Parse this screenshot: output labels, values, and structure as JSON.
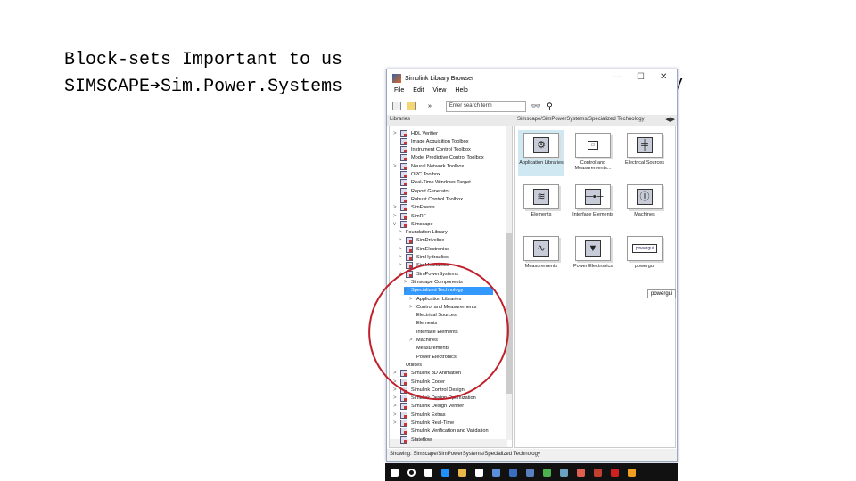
{
  "slide": {
    "line1": "Block-sets Important to us",
    "line2": "SIMSCAPE➔Sim.Power.Systems",
    "line2_tail": "y"
  },
  "window": {
    "title": "Simulink Library Browser",
    "minimize": "—",
    "maximize": "☐",
    "close": "✕"
  },
  "menu": [
    "File",
    "Edit",
    "View",
    "Help"
  ],
  "toolbar": {
    "search_placeholder": "Enter search term",
    "more": "»"
  },
  "address": {
    "left_header": "Libraries",
    "path": "Simscape/SimPowerSystems/Specialized Technology"
  },
  "tree": [
    {
      "label": "HDL Verifier",
      "level": 0,
      "exp": ">"
    },
    {
      "label": "Image Acquisition Toolbox",
      "level": 0,
      "exp": ""
    },
    {
      "label": "Instrument Control Toolbox",
      "level": 0,
      "exp": ""
    },
    {
      "label": "Model Predictive Control Toolbox",
      "level": 0,
      "exp": ""
    },
    {
      "label": "Neural Network Toolbox",
      "level": 0,
      "exp": ">"
    },
    {
      "label": "OPC Toolbox",
      "level": 0,
      "exp": ""
    },
    {
      "label": "Real-Time Windows Target",
      "level": 0,
      "exp": ""
    },
    {
      "label": "Report Generator",
      "level": 0,
      "exp": ""
    },
    {
      "label": "Robust Control Toolbox",
      "level": 0,
      "exp": ""
    },
    {
      "label": "SimEvents",
      "level": 0,
      "exp": ">"
    },
    {
      "label": "SimRF",
      "level": 0,
      "exp": ">"
    },
    {
      "label": "Simscape",
      "level": 0,
      "exp": "v"
    },
    {
      "label": "Foundation Library",
      "level": 1,
      "exp": ">",
      "noicon": true
    },
    {
      "label": "SimDriveline",
      "level": 1,
      "exp": ">"
    },
    {
      "label": "SimElectronics",
      "level": 1,
      "exp": ">"
    },
    {
      "label": "SimHydraulics",
      "level": 1,
      "exp": ">"
    },
    {
      "label": "SimMechanics",
      "level": 1,
      "exp": ">"
    },
    {
      "label": "SimPowerSystems",
      "level": 1,
      "exp": "v"
    },
    {
      "label": "Simscape Components",
      "level": 2,
      "exp": ">",
      "noicon": true
    },
    {
      "label": "Specialized Technology",
      "level": 2,
      "exp": "v",
      "noicon": true,
      "selected": true
    },
    {
      "label": "Application Libraries",
      "level": 3,
      "exp": ">",
      "noicon": true
    },
    {
      "label": "Control and Measurements",
      "level": 3,
      "exp": ">",
      "noicon": true
    },
    {
      "label": "Electrical Sources",
      "level": 3,
      "exp": "",
      "noicon": true
    },
    {
      "label": "Elements",
      "level": 3,
      "exp": "",
      "noicon": true
    },
    {
      "label": "Interface Elements",
      "level": 3,
      "exp": "",
      "noicon": true
    },
    {
      "label": "Machines",
      "level": 3,
      "exp": ">",
      "noicon": true
    },
    {
      "label": "Measurements",
      "level": 3,
      "exp": "",
      "noicon": true
    },
    {
      "label": "Power Electronics",
      "level": 3,
      "exp": "",
      "noicon": true
    },
    {
      "label": "Utilities",
      "level": 1,
      "exp": "",
      "noicon": true
    },
    {
      "label": "Simulink 3D Animation",
      "level": 0,
      "exp": ">"
    },
    {
      "label": "Simulink Coder",
      "level": 0,
      "exp": ">"
    },
    {
      "label": "Simulink Control Design",
      "level": 0,
      "exp": ">"
    },
    {
      "label": "Simulink Design Optimization",
      "level": 0,
      "exp": ">"
    },
    {
      "label": "Simulink Design Verifier",
      "level": 0,
      "exp": ">"
    },
    {
      "label": "Simulink Extras",
      "level": 0,
      "exp": ">"
    },
    {
      "label": "Simulink Real-Time",
      "level": 0,
      "exp": ">"
    },
    {
      "label": "Simulink Verification and Validation",
      "level": 0,
      "exp": ""
    },
    {
      "label": "Stateflow",
      "level": 0,
      "exp": ""
    }
  ],
  "blocks": [
    {
      "label": "Application Libraries",
      "glyph": "⚙",
      "selected": true
    },
    {
      "label": "Control and Measurements...",
      "glyph": "▭"
    },
    {
      "label": "Electrical Sources",
      "glyph": "╪"
    },
    {
      "label": "Elements",
      "glyph": "≋"
    },
    {
      "label": "Interface Elements",
      "glyph": "─•─"
    },
    {
      "label": "Machines",
      "glyph": "Ⓘ"
    },
    {
      "label": "Measurements",
      "glyph": "∿"
    },
    {
      "label": "Power Electronics",
      "glyph": "▼"
    },
    {
      "label": "powergui",
      "glyph": "powergui"
    }
  ],
  "tooltip": "powergui",
  "status": "Showing: Simscape/SimPowerSystems/Specialized Technology",
  "taskbar_colors": [
    "#ffffff",
    "#ffffff",
    "#ffffff",
    "#1e90ff",
    "#e8b84a",
    "#ffffff",
    "#5b8fd9",
    "#3a6fbf",
    "#5a7fbf",
    "#4caf50",
    "#6aa0c0",
    "#e06050",
    "#c04030",
    "#d02020",
    "#f0a020"
  ]
}
